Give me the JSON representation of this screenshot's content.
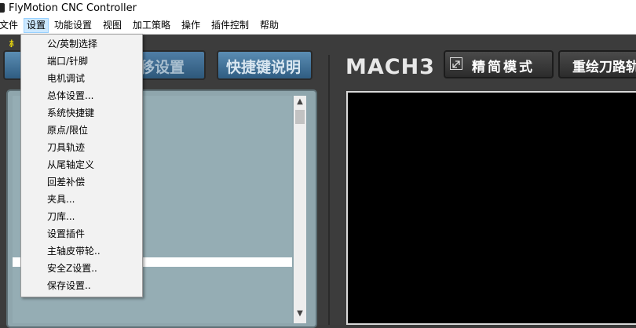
{
  "window": {
    "title": "FlyMotion CNC Controller"
  },
  "menubar": {
    "items": [
      {
        "label": "文件"
      },
      {
        "label": "设置",
        "active": true
      },
      {
        "label": "功能设置"
      },
      {
        "label": "视图"
      },
      {
        "label": "加工策略"
      },
      {
        "label": "操作"
      },
      {
        "label": "插件控制"
      },
      {
        "label": "帮助"
      }
    ]
  },
  "dropdown": {
    "items": [
      "公/英制选择",
      "端口/针脚",
      "电机调试",
      "总体设置...",
      "系统快捷键",
      "原点/限位",
      "刀具轨迹",
      "从尾轴定义",
      "回差补偿",
      "夹具...",
      "刀库...",
      "设置插件",
      "主轴皮带轮..",
      "安全Z设置..",
      "保存设置.."
    ]
  },
  "toolbar": {
    "warning_text": "ﾎ",
    "move_settings_label": "移设置",
    "shortcut_help_label": "快捷键说明",
    "logo_text": "MACH3",
    "compact_mode_label": "精简模式",
    "redraw_label": "重绘刀路轨"
  },
  "colors": {
    "accent_blue": "#2f5d82",
    "viewport_bg": "#000000",
    "list_bg": "#95adb4",
    "logo_accent": "#4aa8d8"
  },
  "icons": {
    "compact_mode": "expand-arrows-icon",
    "scroll_up": "chevron-up-icon",
    "scroll_down": "chevron-down-icon"
  }
}
